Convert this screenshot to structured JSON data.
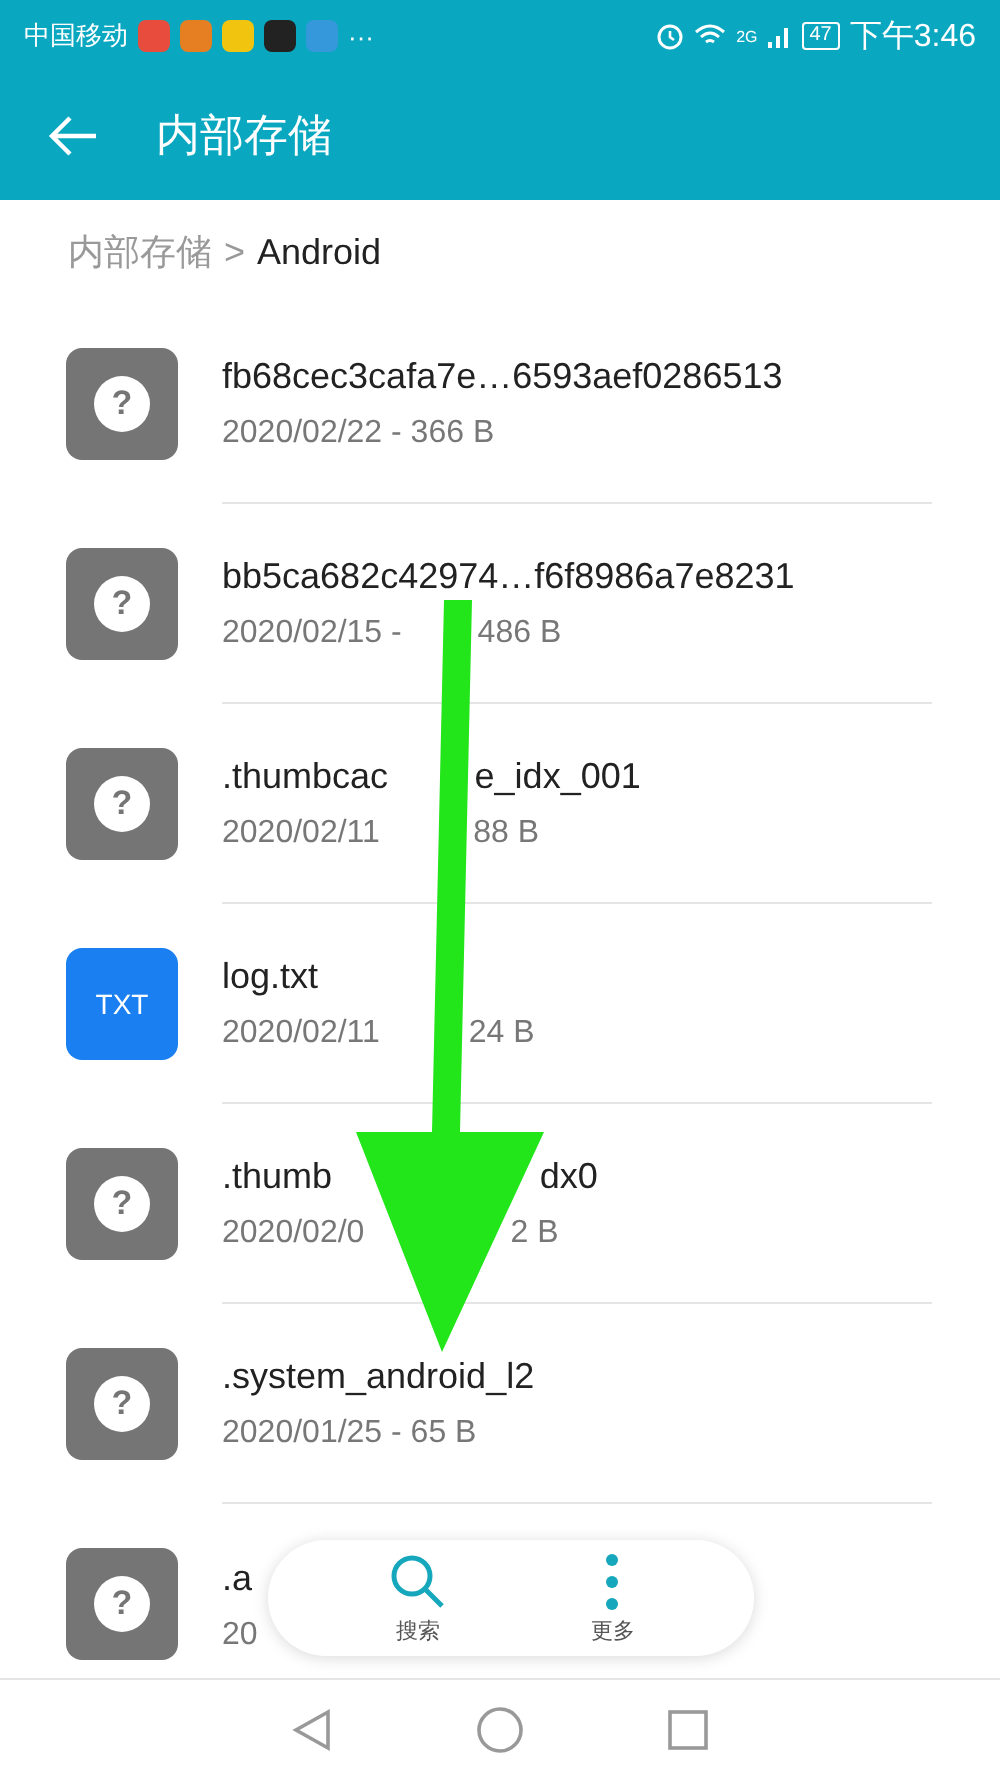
{
  "status_bar": {
    "carrier": "中国移动",
    "more": "···",
    "network": "2G",
    "battery": "47",
    "time": "下午3:46"
  },
  "header": {
    "title": "内部存储"
  },
  "breadcrumb": {
    "parent": "内部存储",
    "separator": ">",
    "current": "Android"
  },
  "files": [
    {
      "kind": "unknown",
      "icon_label": "?",
      "name": [
        "fb68cec3cafa7e…6593aef0286513"
      ],
      "meta": [
        "2020/02/22 - 366 B"
      ]
    },
    {
      "kind": "unknown",
      "icon_label": "?",
      "name": [
        "bb5ca682c42974…f6f8986a7e8231"
      ],
      "meta": [
        "2020/02/15 -",
        "486 B"
      ]
    },
    {
      "kind": "unknown",
      "icon_label": "?",
      "name": [
        ".thumbcac",
        "e_idx_001"
      ],
      "meta": [
        "2020/02/11",
        "88 B"
      ]
    },
    {
      "kind": "text",
      "icon_label": "TXT",
      "name": [
        "log.txt"
      ],
      "meta": [
        "2020/02/11",
        "24 B"
      ]
    },
    {
      "kind": "unknown",
      "icon_label": "?",
      "name": [
        ".thumb",
        "dx0"
      ],
      "meta": [
        "2020/02/0",
        "2 B"
      ]
    },
    {
      "kind": "unknown",
      "icon_label": "?",
      "name": [
        ".system_android_l2"
      ],
      "meta": [
        "2020/01/25 - 65 B"
      ]
    },
    {
      "kind": "unknown",
      "icon_label": "?",
      "name": [
        ".a"
      ],
      "meta": [
        "20"
      ]
    }
  ],
  "floating_bar": [
    {
      "kind": "search",
      "label": "搜索"
    },
    {
      "kind": "more",
      "label": "更多"
    }
  ]
}
